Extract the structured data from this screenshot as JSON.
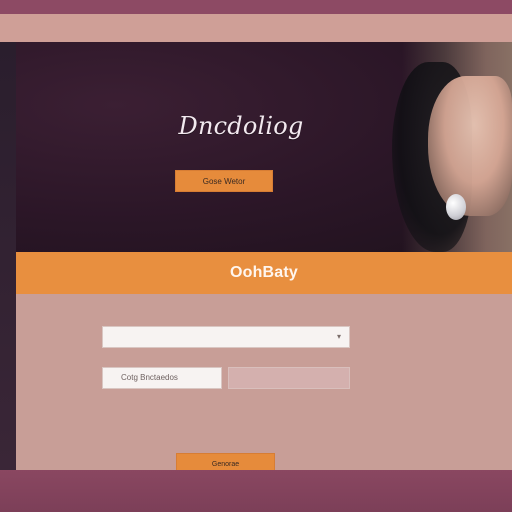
{
  "hero": {
    "title": "Dncdoliog",
    "cta_label": "Gose Wetor"
  },
  "band": {
    "title": "OohBaty"
  },
  "form": {
    "field1_value": "",
    "field2_value": "Cotg Bnctaedos",
    "submit_label": "Genorae"
  },
  "icons": {
    "dropdown": "chevron-down-icon"
  },
  "colors": {
    "accent": "#e88f3f",
    "panel": "#c89e97",
    "frame": "#8d4a64"
  }
}
